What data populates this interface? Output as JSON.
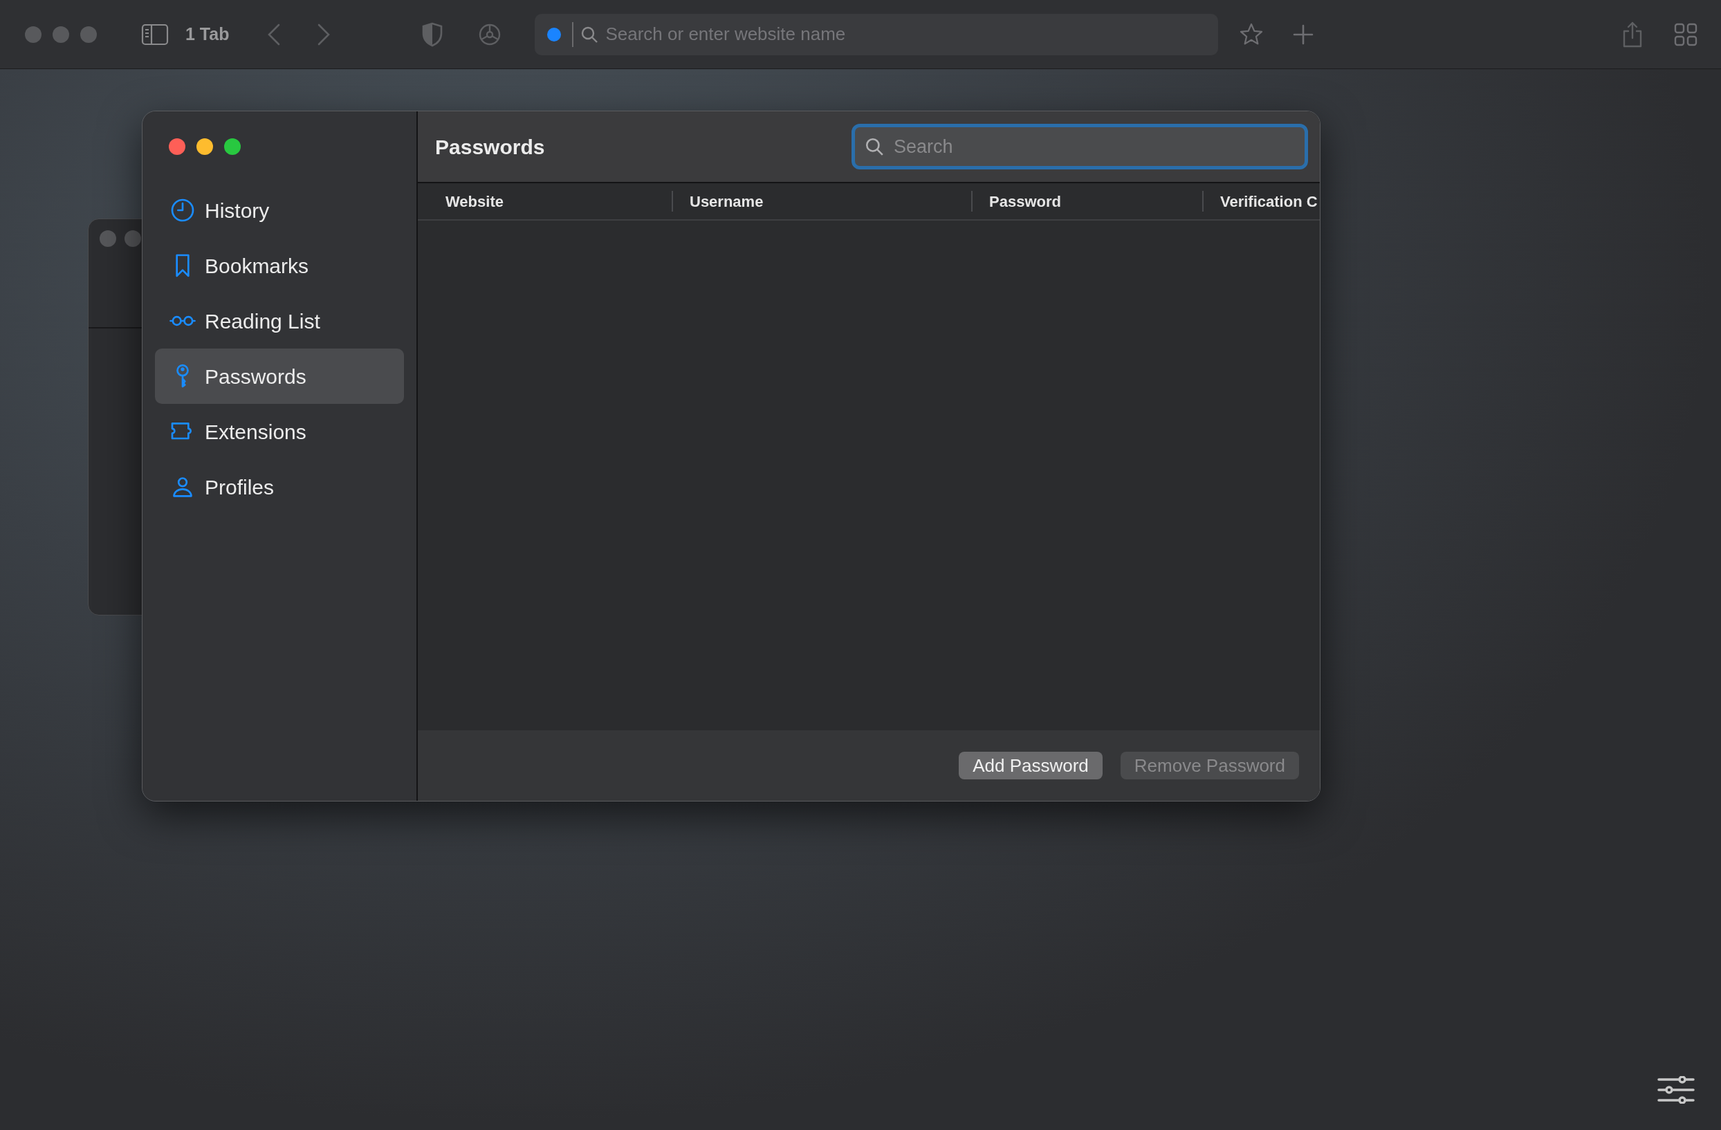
{
  "toolbar": {
    "tab_count": "1 Tab",
    "address": {
      "placeholder": "Search or enter website name"
    }
  },
  "window": {
    "title": "Passwords",
    "search": {
      "placeholder": "Search"
    },
    "sidebar": {
      "items": [
        {
          "label": "History",
          "kind": "clock",
          "selected": false
        },
        {
          "label": "Bookmarks",
          "kind": "bookmark",
          "selected": false
        },
        {
          "label": "Reading List",
          "kind": "glasses",
          "selected": false
        },
        {
          "label": "Passwords",
          "kind": "key",
          "selected": true
        },
        {
          "label": "Extensions",
          "kind": "puzzle",
          "selected": false
        },
        {
          "label": "Profiles",
          "kind": "person",
          "selected": false
        }
      ]
    },
    "table": {
      "columns": [
        "Website",
        "Username",
        "Password",
        "Verification C"
      ]
    },
    "buttons": [
      {
        "label": "Add Password",
        "disabled": false
      },
      {
        "label": "Remove Password",
        "disabled": true
      }
    ]
  }
}
